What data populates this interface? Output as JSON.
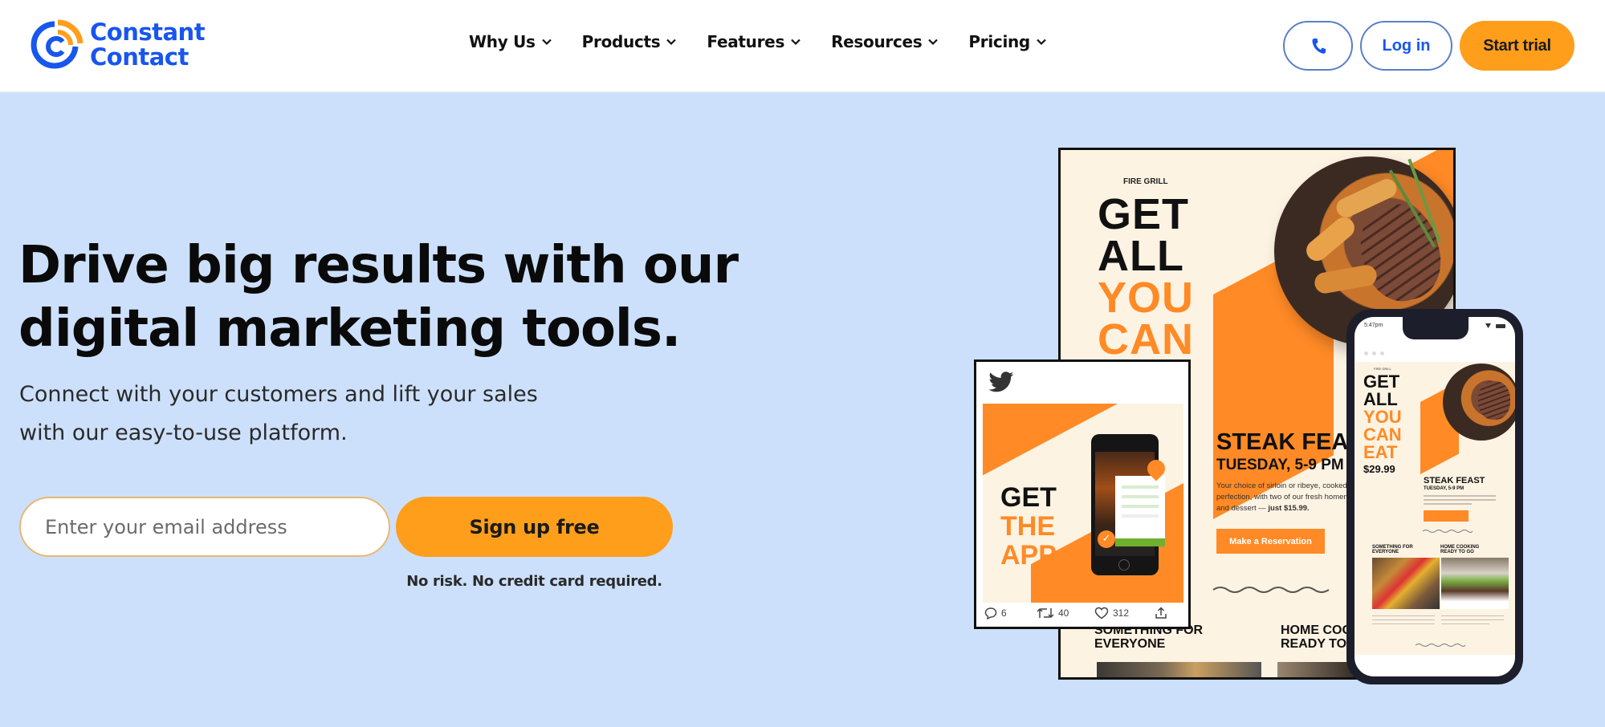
{
  "header": {
    "logo": {
      "line1": "Constant",
      "line2": "Contact"
    },
    "nav": [
      {
        "label": "Why Us"
      },
      {
        "label": "Products"
      },
      {
        "label": "Features"
      },
      {
        "label": "Resources"
      },
      {
        "label": "Pricing"
      }
    ],
    "phone_icon": "phone-icon",
    "login_label": "Log in",
    "trial_label": "Start trial"
  },
  "hero": {
    "title_line1": "Drive big results with our",
    "title_line2": "digital marketing tools.",
    "subtitle_line1": "Connect with your customers and lift your sales",
    "subtitle_line2": "with our easy-to-use platform.",
    "email_placeholder": "Enter your email address",
    "email_value": "",
    "signup_label": "Sign up free",
    "note": "No risk. No credit card required."
  },
  "illustration": {
    "poster": {
      "brand": "FIRE GRILL",
      "headline": [
        "GET",
        "ALL",
        "YOU",
        "CAN"
      ],
      "event_title": "STEAK FEAST",
      "event_time": "TUESDAY, 5-9 PM",
      "description_lines": [
        "Your choice of sirloin or ribeye, cooked to",
        "perfection, with two of our fresh homemade sides",
        "and dessert — "
      ],
      "description_price": "just $15.99.",
      "cta": "Make a Reservation",
      "section1": [
        "SOMETHING FOR",
        "EVERYONE"
      ],
      "section2": [
        "HOME COOKING",
        "READY TO GO"
      ]
    },
    "tweet": {
      "icon": "twitter-bird-icon",
      "headline": [
        "GET",
        "THE",
        "APP"
      ],
      "replies": "6",
      "retweets": "40",
      "likes": "312"
    },
    "phone": {
      "time": "5:47pm",
      "brand": "FIRE GRILL",
      "headline": [
        "GET",
        "ALL",
        "YOU",
        "CAN",
        "EAT"
      ],
      "price": "$29.99",
      "event_title": "STEAK FEAST",
      "event_time": "TUESDAY, 5-9 PM",
      "section1": [
        "SOMETHING FOR",
        "EVERYONE"
      ],
      "section2": [
        "HOME COOKING",
        "READY TO GO"
      ]
    }
  },
  "colors": {
    "brand_blue": "#1856ed",
    "brand_orange": "#ff9e1b",
    "poster_orange": "#ff8a26",
    "hero_bg": "#cde0fb",
    "poster_bg": "#fdf3e3"
  }
}
